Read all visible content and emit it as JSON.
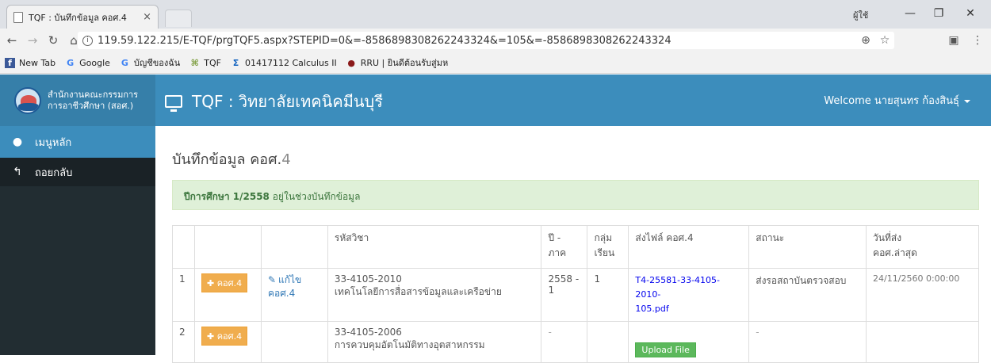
{
  "browser": {
    "tab_title": "TQF : บันทึกข้อมูล คอศ.4",
    "tab_close": "×",
    "window_user": "ผู้ใช้",
    "window_minimize": "—",
    "window_restore": "❐",
    "window_close": "✕",
    "url": "119.59.122.215/E-TQF/prgTQF5.aspx?STEPID=0&=-8586898308262243324&=105&=-8586898308262243324",
    "bookmarks": [
      {
        "icon": "f",
        "label": "New Tab"
      },
      {
        "icon": "G",
        "label": "Google"
      },
      {
        "icon": "G",
        "label": "บัญชีของฉัน"
      },
      {
        "icon": "⌘",
        "label": "TQF"
      },
      {
        "icon": "Σ",
        "label": "01417112 Calculus II"
      },
      {
        "icon": "●",
        "label": "RRU | ยินดีต้อนรับสู่มห"
      }
    ]
  },
  "header": {
    "brand_line1": "สำนักงานคณะกรรมการ",
    "brand_line2": "การอาชีวศึกษา (สอศ.)",
    "title": "TQF : วิทยาลัยเทคนิคมีนบุรี",
    "welcome": "Welcome นายสุนทร ก้องสินธุ์"
  },
  "sidebar": {
    "items": [
      {
        "icon": "●",
        "label": "เมนูหลัก"
      },
      {
        "icon": "↰",
        "label": "ถอยกลับ"
      }
    ]
  },
  "main": {
    "title": "บันทึกข้อมูล คอศ.",
    "title_num": "4",
    "alert_bold": "ปีการศึกษา 1/2558",
    "alert_text": " อยู่ในช่วงบันทึกข้อมูล",
    "table": {
      "headers": [
        "",
        "",
        "",
        "รหัสวิชา",
        "ปี - ภาค",
        "กลุ่ม\nเรียน",
        "ส่งไฟล์ คอศ.4",
        "สถานะ",
        "วันที่ส่ง\nคอศ.ล่าสุด"
      ],
      "rows": [
        {
          "no": "1",
          "btn": "✚ คอศ.4",
          "edit_line1": "แก้ไข",
          "edit_line2": "คอศ.4",
          "code": "33-4105-2010",
          "name": "เทคโนโลยีการสื่อสารข้อมูลและเครือข่าย",
          "term": "2558 -\n1",
          "group": "1",
          "file_line1": "T4-25581-33-4105-2010-",
          "file_line2": "105.pdf",
          "status": "ส่งรอสถาบันตรวจสอบ",
          "date": "24/11/2560 0:00:00"
        },
        {
          "no": "2",
          "btn": "✚ คอศ.4",
          "code": "33-4105-2006",
          "name": "การควบคุมอัตโนมัติทางอุตสาหกรรม",
          "term": "-",
          "upload": "Upload File",
          "status": "-"
        }
      ]
    }
  }
}
